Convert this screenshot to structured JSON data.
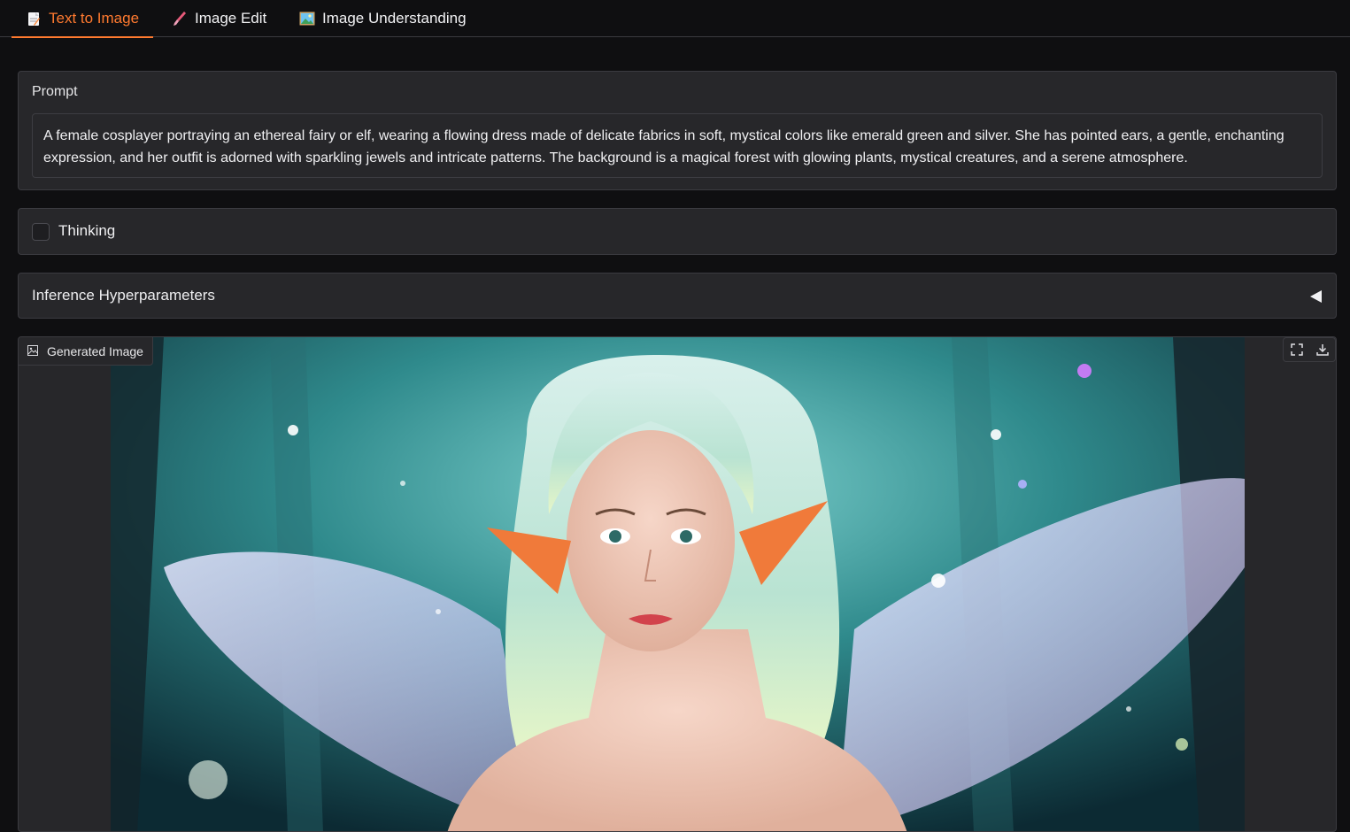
{
  "tabs": [
    {
      "label": "Text to Image",
      "icon": "memo-icon",
      "active": true
    },
    {
      "label": "Image Edit",
      "icon": "paintbrush-icon",
      "active": false
    },
    {
      "label": "Image Understanding",
      "icon": "framed-picture-icon",
      "active": false
    }
  ],
  "prompt": {
    "label": "Prompt",
    "value": "A female cosplayer portraying an ethereal fairy or elf, wearing a flowing dress made of delicate fabrics in soft, mystical colors like emerald green and silver. She has pointed ears, a gentle, enchanting expression, and her outfit is adorned with sparkling jewels and intricate patterns. The background is a magical forest with glowing plants, mystical creatures, and a serene atmosphere."
  },
  "thinking": {
    "label": "Thinking",
    "checked": false
  },
  "hyperparameters": {
    "label": "Inference Hyperparameters",
    "expanded": false
  },
  "output": {
    "label": "Generated Image",
    "actions": [
      "fullscreen-icon",
      "download-icon"
    ]
  },
  "colors": {
    "accent": "#ff7a2f",
    "background": "#0f0f11",
    "panel": "#27272a"
  }
}
